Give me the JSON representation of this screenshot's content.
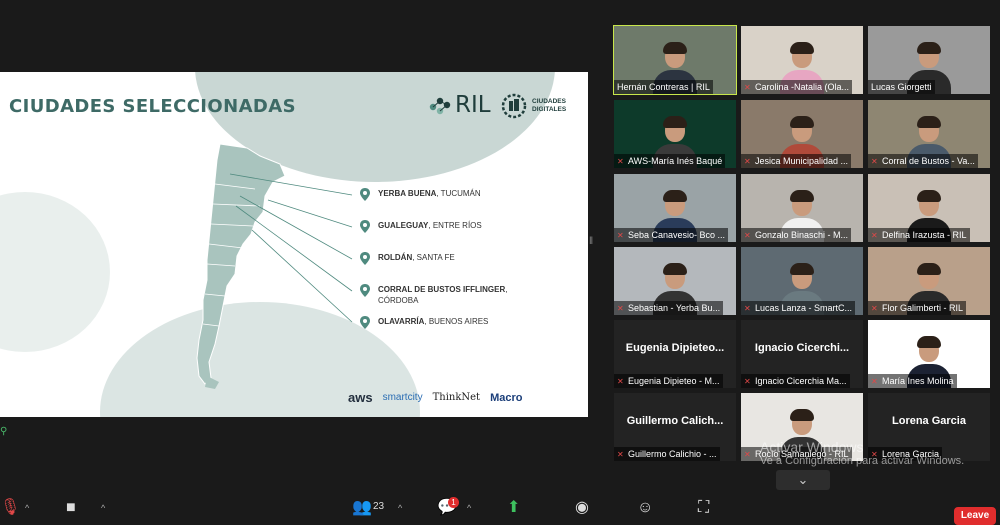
{
  "slide": {
    "title": "CIUDADES SELECCIONADAS",
    "logo_ril": "RIL",
    "logo_cd_line1": "CIUDADES",
    "logo_cd_line2": "DIGITALES",
    "cities": [
      {
        "bold": "YERBA BUENA",
        "rest": ", TUCUMÁN",
        "line2": ""
      },
      {
        "bold": "GUALEGUAY",
        "rest": ", ENTRE RÍOS",
        "line2": ""
      },
      {
        "bold": "ROLDÁN",
        "rest": ", SANTA FE",
        "line2": ""
      },
      {
        "bold": "CORRAL DE BUSTOS IFFLINGER",
        "rest": ",",
        "line2": "CÓRDOBA"
      },
      {
        "bold": "OLAVARRÍA",
        "rest": ", BUENOS AIRES",
        "line2": ""
      }
    ],
    "sponsors": {
      "aws": "aws",
      "smartcity": "smartcity",
      "thinknet": "ThinkNet",
      "macro": "Macro"
    }
  },
  "participants": [
    {
      "name": "Hernán Contreras | RIL",
      "muted": false,
      "video": true,
      "active": true,
      "bg": "#6e7a6a",
      "shirt": "#2c3440"
    },
    {
      "name": "Carolina -Natalia (Ola...",
      "muted": true,
      "video": true,
      "bg": "#d9d2c8",
      "shirt": "#e7a6c2"
    },
    {
      "name": "Lucas Giorgetti",
      "muted": false,
      "video": true,
      "bg": "#9a9a9a",
      "shirt": "#2a2a2a"
    },
    {
      "name": "AWS-María Inés Baqué",
      "muted": true,
      "video": true,
      "bg": "#0d3a2a",
      "shirt": "#3a3a3a"
    },
    {
      "name": "Jesica Municipalidad ...",
      "muted": true,
      "video": true,
      "bg": "#8a7a6a",
      "shirt": "#b04a3a"
    },
    {
      "name": "Corral de Bustos - Va...",
      "muted": true,
      "video": true,
      "bg": "#8e8672",
      "shirt": "#4a5a6a"
    },
    {
      "name": "Seba Canavesio- Bco ...",
      "muted": true,
      "video": true,
      "bg": "#9aa3a6",
      "shirt": "#2a3c5a"
    },
    {
      "name": "Gonzalo Binaschi - M...",
      "muted": true,
      "video": true,
      "bg": "#b8b4ae",
      "shirt": "#f0f0f0"
    },
    {
      "name": "Delfina Irazusta - RIL",
      "muted": true,
      "video": true,
      "bg": "#c9c0b6",
      "shirt": "#1a1a1a"
    },
    {
      "name": "Sebastian - Yerba Bu...",
      "muted": true,
      "video": true,
      "bg": "#b4b8bc",
      "shirt": "#333333"
    },
    {
      "name": "Lucas Lanza - SmartC...",
      "muted": true,
      "video": true,
      "bg": "#5e6a72",
      "shirt": "#6a7a80"
    },
    {
      "name": "Flor Galimberti - RIL",
      "muted": true,
      "video": true,
      "bg": "#b9a08a",
      "shirt": "#2a2a2a"
    },
    {
      "name": "Eugenia Dipieteo - M...",
      "muted": true,
      "video": false,
      "display": "Eugenia  Dipieteo..."
    },
    {
      "name": "Ignacio Cicerchia Ma...",
      "muted": true,
      "video": false,
      "display": "Ignacio  Cicerchi..."
    },
    {
      "name": "María Ines Molina",
      "muted": true,
      "video": true,
      "bg": "#ffffff",
      "shirt": "#1c2233"
    },
    {
      "name": "Guillermo Calichio - ...",
      "muted": true,
      "video": false,
      "display": "Guillermo  Calich..."
    },
    {
      "name": "Rocío Samaniego - RIL",
      "muted": true,
      "video": true,
      "bg": "#e8e6e2",
      "shirt": "#333333"
    },
    {
      "name": "Lorena Garcia",
      "muted": true,
      "video": false,
      "display": "Lorena Garcia"
    }
  ],
  "watermark": {
    "line1": "Activar Windows",
    "line2": "Ve a Configuración para activar Windows."
  },
  "toolbar": {
    "participants_count": "23",
    "chat_badge": "1",
    "leave": "Leave"
  }
}
